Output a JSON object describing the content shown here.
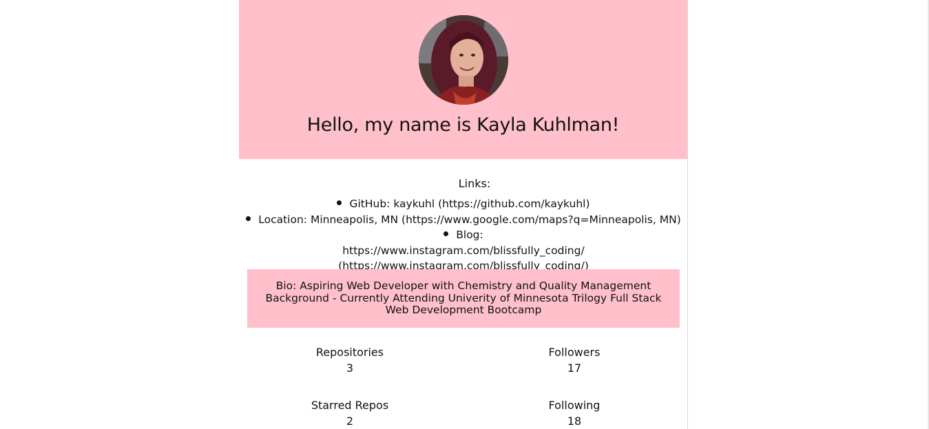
{
  "profile": {
    "heading": "Hello, my name is Kayla Kuhlman!",
    "avatar_icon": "profile-photo",
    "links_label": "Links:",
    "links": [
      {
        "text": "GitHub: kaykuhl (https://github.com/kaykuhl)"
      },
      {
        "text": "Location: Minneapolis, MN (https://www.google.com/maps?q=Minneapolis, MN)"
      },
      {
        "text": "Blog: https://www.instagram.com/blissfully_coding/ (https://www.instagram.com/blissfully_coding/)"
      }
    ],
    "bio": "Bio: Aspiring Web Developer with Chemistry and Quality Management Background - Currently Attending Univerity of Minnesota Trilogy Full Stack Web Development Bootcamp",
    "stats": {
      "repositories": {
        "label": "Repositories",
        "value": "3"
      },
      "followers": {
        "label": "Followers",
        "value": "17"
      },
      "starred": {
        "label": "Starred Repos",
        "value": "2"
      },
      "following": {
        "label": "Following",
        "value": "18"
      }
    }
  },
  "colors": {
    "accent_pink": "#ffc0cb",
    "text": "#111111",
    "background": "#ffffff"
  }
}
